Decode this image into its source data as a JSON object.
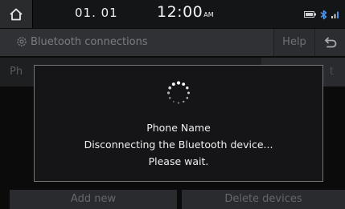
{
  "status_bar": {
    "home_icon": "home-icon",
    "date": "01. 01",
    "time": "12:00",
    "time_suffix": "AM",
    "tray_icons": [
      "phone-battery-icon",
      "bluetooth-icon",
      "signal-icon"
    ]
  },
  "title_bar": {
    "icon": "gear-icon",
    "title": "Bluetooth connections",
    "help_label": "Help",
    "back_icon": "back-arrow-icon"
  },
  "background": {
    "row_label": "Ph",
    "row_tail_label": "t"
  },
  "popup": {
    "spinner_icon": "loading-spinner-icon",
    "device_name": "Phone Name",
    "message": "Disconnecting the Bluetooth device...",
    "sub_message": "Please wait."
  },
  "bottom_buttons": {
    "add_new": "Add new",
    "delete_devices": "Delete devices"
  },
  "colors": {
    "popup_border": "#75767a",
    "title_bar": "#303134",
    "background": "#0b0b0c"
  }
}
